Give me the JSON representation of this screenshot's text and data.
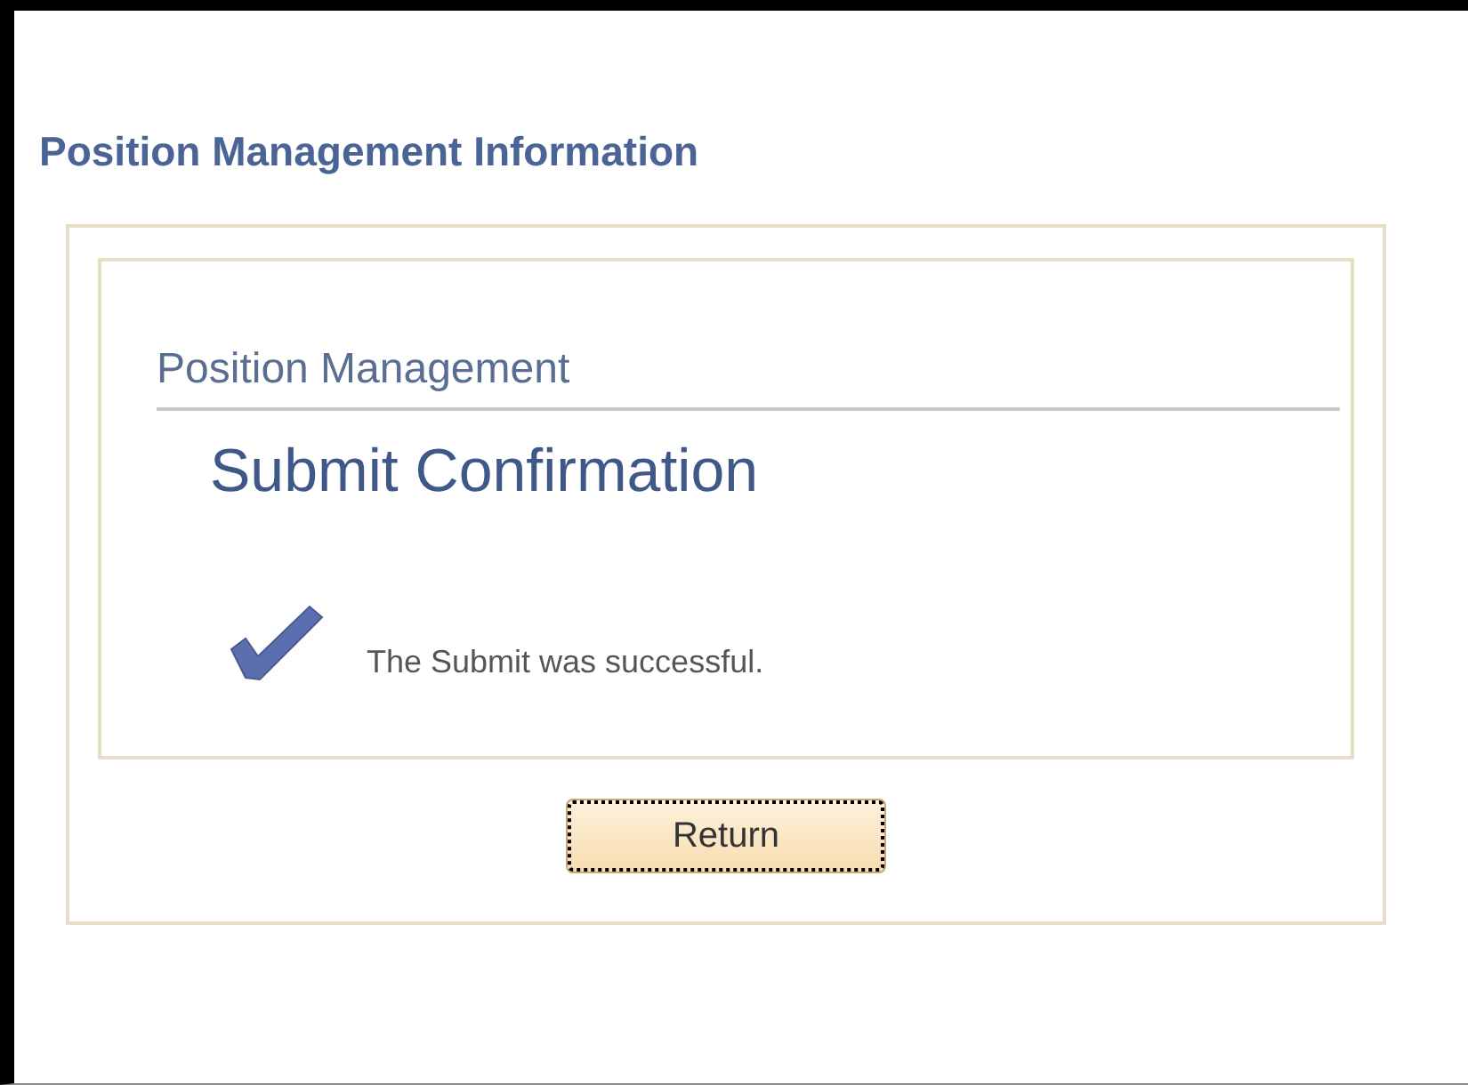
{
  "page_title": "Position Management Information",
  "section_title": "Position Management",
  "confirmation": {
    "title": "Submit Confirmation",
    "message": "The Submit was successful."
  },
  "buttons": [
    {
      "label": "Return",
      "focused": true
    }
  ]
}
